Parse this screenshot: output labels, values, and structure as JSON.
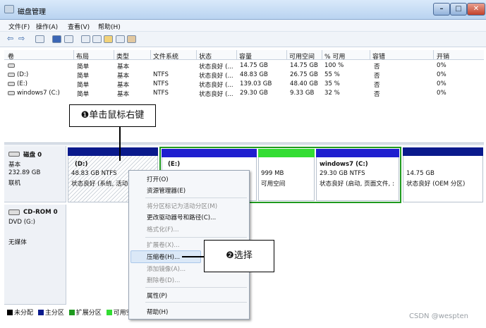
{
  "window": {
    "title": "磁盘管理",
    "min": "–",
    "max": "□",
    "close": "✕"
  },
  "menu": [
    "文件(F)",
    "操作(A)",
    "查看(V)",
    "帮助(H)"
  ],
  "toolbar": {
    "icons": [
      "back-icon",
      "forward-icon",
      "properties-icon",
      "help-icon",
      "view-icon",
      "refresh-icon",
      "export-icon",
      "open-icon",
      "search-icon",
      "settings-icon"
    ]
  },
  "volumes": {
    "headers": [
      "卷",
      "布局",
      "类型",
      "文件系统",
      "状态",
      "容量",
      "可用空间",
      "% 可用",
      "容错",
      "开销"
    ],
    "rows": [
      [
        "",
        "简单",
        "基本",
        "",
        "状态良好 (...",
        "14.75 GB",
        "14.75 GB",
        "100 %",
        "否",
        "0%"
      ],
      [
        "(D:)",
        "简单",
        "基本",
        "NTFS",
        "状态良好 (...",
        "48.83 GB",
        "26.75 GB",
        "55 %",
        "否",
        "0%"
      ],
      [
        "(E:)",
        "简单",
        "基本",
        "NTFS",
        "状态良好 (...",
        "139.03 GB",
        "48.40 GB",
        "35 %",
        "否",
        "0%"
      ],
      [
        "windows7 (C:)",
        "简单",
        "基本",
        "NTFS",
        "状态良好 (...",
        "29.30 GB",
        "9.33 GB",
        "32 %",
        "否",
        "0%"
      ]
    ]
  },
  "annotation1": "❶单击鼠标右键",
  "annotation2": "❷选择",
  "disk0": {
    "name": "磁盘 0",
    "type": "基本",
    "size": "232.89 GB",
    "status": "联机",
    "partitions": [
      {
        "name": "(D:)",
        "size": "48.83 GB NTFS",
        "status": "状态良好 (系统, 活动"
      },
      {
        "name": "(E:)",
        "size": "",
        "status": ""
      },
      {
        "name": "",
        "size": "999 MB",
        "status": "可用空间"
      },
      {
        "name": "windows7  (C:)",
        "size": "29.30 GB NTFS",
        "status": "状态良好 (启动, 页面文件, :"
      },
      {
        "name": "",
        "size": "14.75 GB",
        "status": "状态良好 (OEM 分区)"
      }
    ]
  },
  "cdrom0": {
    "name": "CD-ROM 0",
    "drive": "DVD (G:)",
    "status": "无媒体"
  },
  "legend": [
    "未分配",
    "主分区",
    "扩展分区",
    "可用空"
  ],
  "context_menu": {
    "items": [
      {
        "label": "打开(O)",
        "enabled": true
      },
      {
        "label": "资源管理器(E)",
        "enabled": true
      },
      {
        "label": "将分区标记为活动分区(M)",
        "enabled": false
      },
      {
        "label": "更改驱动器号和路径(C)...",
        "enabled": true
      },
      {
        "label": "格式化(F)...",
        "enabled": false
      },
      {
        "label": "扩展卷(X)...",
        "enabled": false
      },
      {
        "label": "压缩卷(H)...",
        "enabled": true,
        "highlighted": true
      },
      {
        "label": "添加镜像(A)...",
        "enabled": false
      },
      {
        "label": "删除卷(D)...",
        "enabled": false
      },
      {
        "label": "属性(P)",
        "enabled": true
      },
      {
        "label": "帮助(H)",
        "enabled": true
      }
    ]
  },
  "colors": {
    "unallocated": "#000000",
    "primary": "#0a1a8c",
    "extended": "#1f9a1f",
    "free": "#33dd33",
    "logical_drive": "#1f1fcf"
  },
  "watermark": "CSDN @wespten"
}
